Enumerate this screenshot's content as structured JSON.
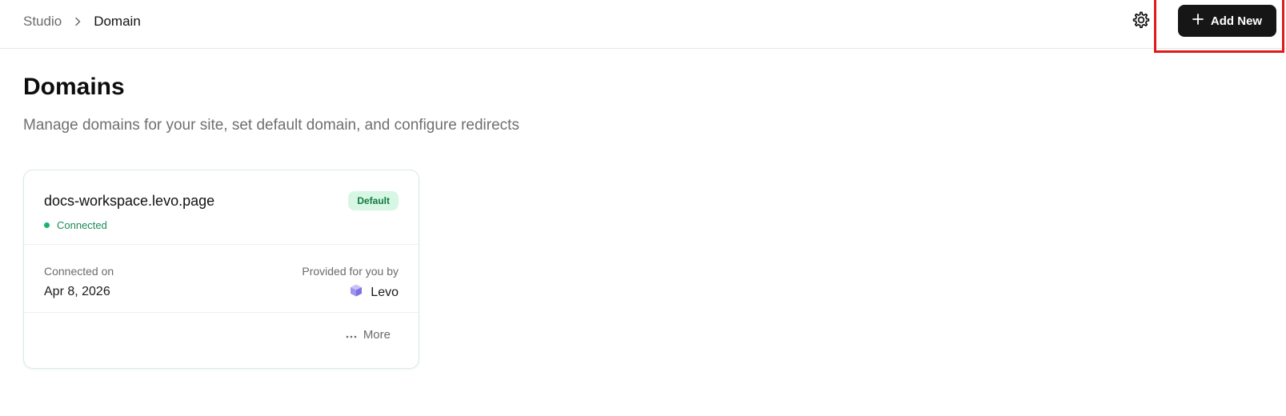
{
  "header": {
    "breadcrumb": {
      "root": "Studio",
      "current": "Domain"
    },
    "settings_icon": "gear-icon",
    "add_new_label": "Add New",
    "add_new_icon": "plus-icon"
  },
  "main": {
    "title": "Domains",
    "subtitle": "Manage domains for your site, set default domain, and configure redirects",
    "domains": [
      {
        "name": "docs-workspace.levo.page",
        "badge": "Default",
        "status": "Connected",
        "connected_on_label": "Connected on",
        "connected_on_value": "Apr 8, 2026",
        "provider_label": "Provided for you by",
        "provider_name": "Levo",
        "provider_icon": "cube-icon",
        "more_label": "More",
        "more_icon": "ellipsis-icon"
      }
    ]
  },
  "colors": {
    "primary_button": "#161616",
    "highlight": "#e01919",
    "badge_bg": "#d7f6e4",
    "badge_text": "#127a3f",
    "status_green": "#19b46e"
  }
}
